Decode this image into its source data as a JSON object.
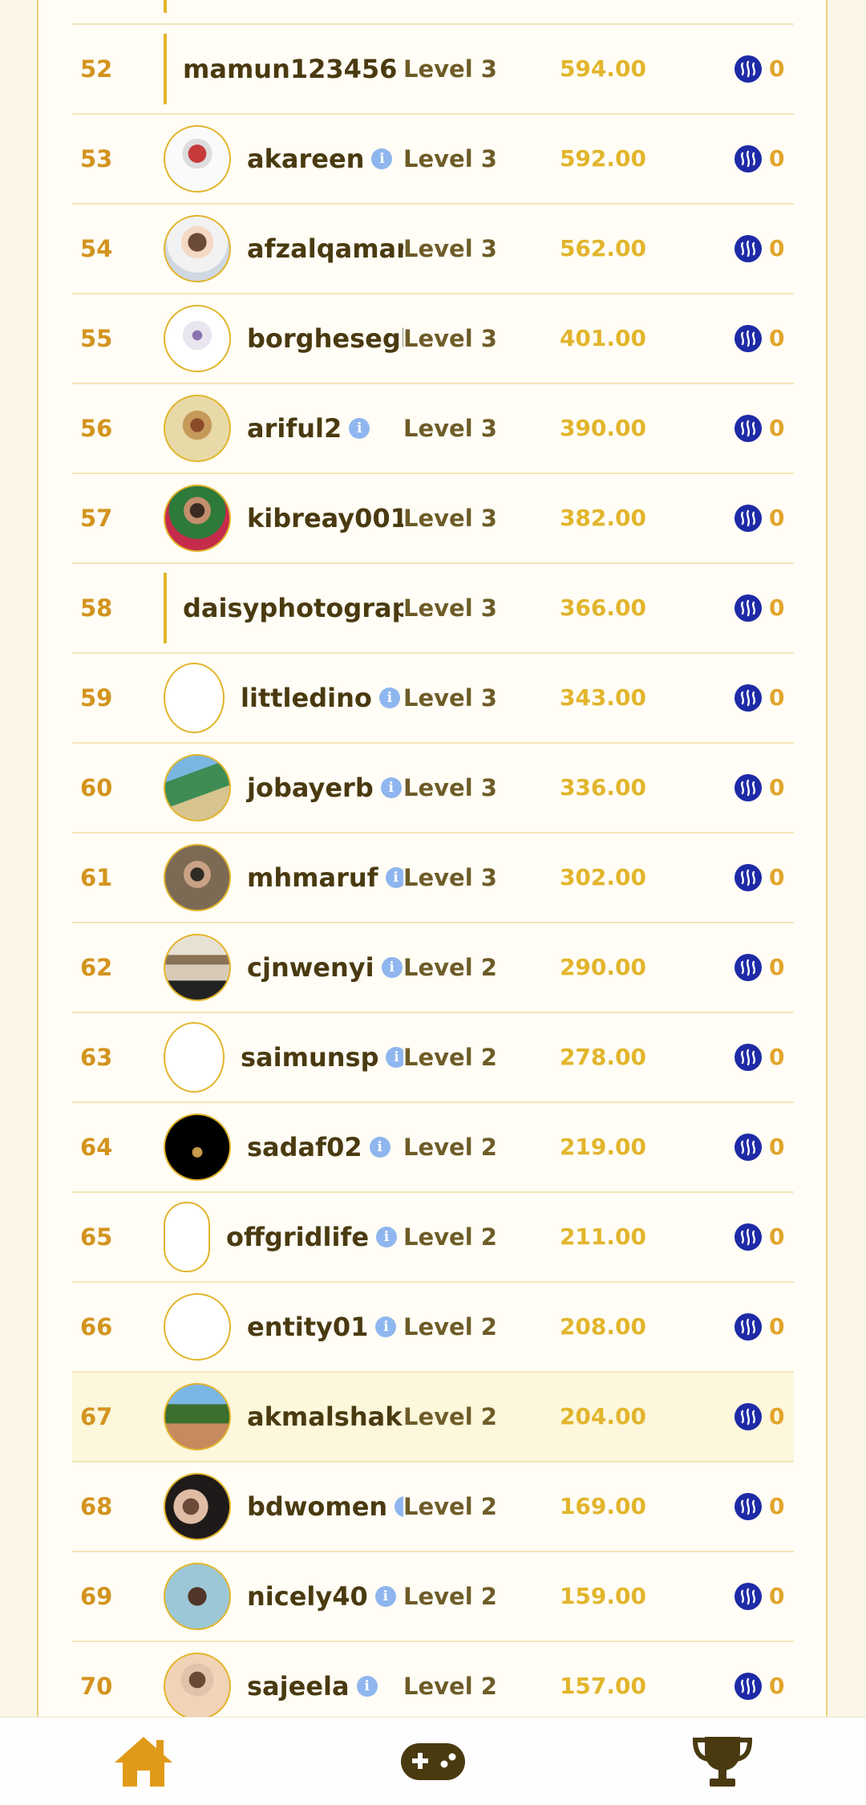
{
  "leaderboard": {
    "rows": [
      {
        "rank": "52",
        "username": "mamun123456",
        "level": "Level 3",
        "points": "594.00",
        "reward": "0",
        "avatar": "bar",
        "info": true
      },
      {
        "rank": "53",
        "username": "akareen",
        "level": "Level 3",
        "points": "592.00",
        "reward": "0",
        "avatar": "img1",
        "info": true
      },
      {
        "rank": "54",
        "username": "afzalqamar",
        "level": "Level 3",
        "points": "562.00",
        "reward": "0",
        "avatar": "img2",
        "info": false
      },
      {
        "rank": "55",
        "username": "borghesegl",
        "level": "Level 3",
        "points": "401.00",
        "reward": "0",
        "avatar": "img3",
        "info": false
      },
      {
        "rank": "56",
        "username": "ariful2",
        "level": "Level 3",
        "points": "390.00",
        "reward": "0",
        "avatar": "img4",
        "info": true
      },
      {
        "rank": "57",
        "username": "kibreay001",
        "level": "Level 3",
        "points": "382.00",
        "reward": "0",
        "avatar": "img5",
        "info": false
      },
      {
        "rank": "58",
        "username": "daisyphotograph",
        "level": "Level 3",
        "points": "366.00",
        "reward": "0",
        "avatar": "bar",
        "info": false
      },
      {
        "rank": "59",
        "username": "littledino",
        "level": "Level 3",
        "points": "343.00",
        "reward": "0",
        "avatar": "empty tall",
        "info": true
      },
      {
        "rank": "60",
        "username": "jobayerb",
        "level": "Level 3",
        "points": "336.00",
        "reward": "0",
        "avatar": "img6",
        "info": true
      },
      {
        "rank": "61",
        "username": "mhmaruf",
        "level": "Level 3",
        "points": "302.00",
        "reward": "0",
        "avatar": "img7",
        "info": true
      },
      {
        "rank": "62",
        "username": "cjnwenyi",
        "level": "Level 2",
        "points": "290.00",
        "reward": "0",
        "avatar": "img8",
        "info": true
      },
      {
        "rank": "63",
        "username": "saimunsp",
        "level": "Level 2",
        "points": "278.00",
        "reward": "0",
        "avatar": "empty tall",
        "info": true
      },
      {
        "rank": "64",
        "username": "sadaf02",
        "level": "Level 2",
        "points": "219.00",
        "reward": "0",
        "avatar": "img9",
        "info": true
      },
      {
        "rank": "65",
        "username": "offgridlife",
        "level": "Level 2",
        "points": "211.00",
        "reward": "0",
        "avatar": "empty narrow",
        "info": true
      },
      {
        "rank": "66",
        "username": "entity01",
        "level": "Level 2",
        "points": "208.00",
        "reward": "0",
        "avatar": "empty",
        "info": true
      },
      {
        "rank": "67",
        "username": "akmalshaki",
        "level": "Level 2",
        "points": "204.00",
        "reward": "0",
        "avatar": "img10",
        "info": false,
        "highlight": true
      },
      {
        "rank": "68",
        "username": "bdwomen",
        "level": "Level 2",
        "points": "169.00",
        "reward": "0",
        "avatar": "img11",
        "info": true
      },
      {
        "rank": "69",
        "username": "nicely40",
        "level": "Level 2",
        "points": "159.00",
        "reward": "0",
        "avatar": "img12",
        "info": true
      },
      {
        "rank": "70",
        "username": "sajeela",
        "level": "Level 2",
        "points": "157.00",
        "reward": "0",
        "avatar": "img13",
        "info": true
      }
    ]
  },
  "icons": {
    "info": "i",
    "steem": "steem-coin-icon",
    "home": "home-icon",
    "games": "gamepad-icon",
    "leaderboard": "trophy-icon"
  },
  "colors": {
    "rank": "#d3941f",
    "points": "#e2b52c",
    "steem": "#1e2aa6",
    "accent": "#e2a52c",
    "home_icon": "#e09a19",
    "game_icon": "#4a3a10",
    "trophy_icon": "#4a3a10"
  }
}
